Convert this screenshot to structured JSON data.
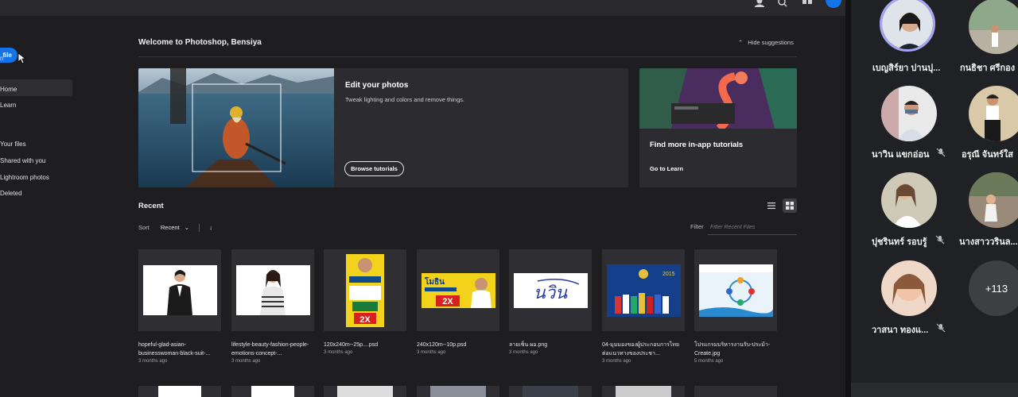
{
  "nav": {
    "new_file": "file",
    "open": "n",
    "items": [
      "Home",
      "Learn",
      "Your files",
      "Shared with you",
      "Lightroom photos",
      "Deleted"
    ]
  },
  "welcome": {
    "title": "Welcome to Photoshop, Bensiya",
    "hide": "Hide suggestions"
  },
  "edit_card": {
    "title": "Edit your photos",
    "desc": "Tweak lighting and colors and remove things.",
    "button": "Browse tutorials"
  },
  "tutorial_card": {
    "title": "Find more in-app tutorials",
    "link": "Go to Learn"
  },
  "recent": {
    "title": "Recent",
    "sort_label": "Sort",
    "sort_value": "Recent",
    "filter_label": "Filter",
    "filter_placeholder": "Filter Recent Files"
  },
  "files": [
    {
      "name": "hopeful-glad-asian-businesswoman-black-suit-...",
      "time": "3 months ago"
    },
    {
      "name": "lifestyle-beauty-fashion-people-emotions-concept-...",
      "time": "3 months ago"
    },
    {
      "name": "120x240m--25p....psd",
      "time": "3 months ago"
    },
    {
      "name": "240x120m--10p.psd",
      "time": "3 months ago"
    },
    {
      "name": "ลายเซ็น ผอ.png",
      "time": "3 months ago"
    },
    {
      "name": "04-มุมมองของผู้ประกอบการไทยต่อแนวทางของประชา...",
      "time": "3 months ago"
    },
    {
      "name": "โปรแกรมบริหารงานรับ-ประม้า-Create.jpg",
      "time": "5 months ago"
    }
  ],
  "thumb_text": {
    "poster_big": "2X",
    "poster_banner": "โมธิน",
    "signature": "นวิน",
    "brochure_year": "2015"
  },
  "participants": [
    {
      "name": "เบญสิร์ยา ปานปุ...",
      "muted": false
    },
    {
      "name": "กนธิชา ศรีกอง",
      "muted": false
    },
    {
      "name": "นาวิน แขกอ่อน",
      "muted": true
    },
    {
      "name": "อรุณี จันทร์ใส",
      "muted": true
    },
    {
      "name": "ปุชรินทร์ รอบรู้",
      "muted": true
    },
    {
      "name": "นางสาววรินล...",
      "muted": true
    },
    {
      "name": "วาสนา ทองแ...",
      "muted": true
    }
  ],
  "more_participants": "+113",
  "colors": {
    "accent": "#1473e6",
    "speaking_ring": "#a6a4f5"
  }
}
